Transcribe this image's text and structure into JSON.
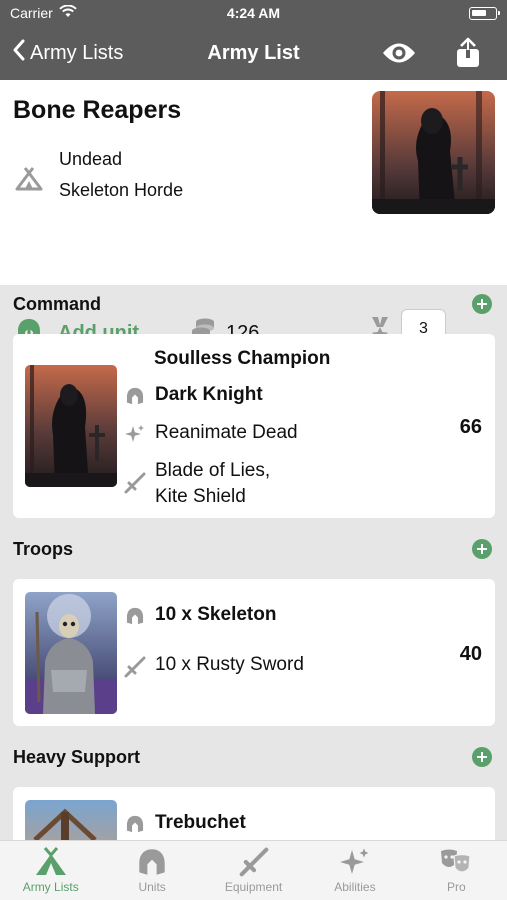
{
  "status_bar": {
    "carrier": "Carrier",
    "time": "4:24 AM"
  },
  "nav": {
    "back_label": "Army Lists",
    "title": "Army List"
  },
  "army": {
    "name": "Bone Reapers",
    "faction_lines": [
      "Undead",
      "Skeleton Horde"
    ],
    "add_unit_label": "Add unit",
    "points": "126",
    "rank_value": "3"
  },
  "sections": [
    {
      "title": "Command",
      "units": [
        {
          "name": "Soulless Champion",
          "type": "Dark Knight",
          "ability": "Reanimate Dead",
          "equipment_lines": [
            "Blade of Lies,",
            "Kite Shield"
          ],
          "points": "66"
        }
      ]
    },
    {
      "title": "Troops",
      "units": [
        {
          "type": "10 x Skeleton",
          "equipment": "10 x Rusty Sword",
          "points": "40"
        }
      ]
    },
    {
      "title": "Heavy Support",
      "units": [
        {
          "type": "Trebuchet"
        }
      ]
    }
  ],
  "tabs": [
    {
      "label": "Army Lists",
      "icon": "tent-icon",
      "active": true
    },
    {
      "label": "Units",
      "icon": "helmet-icon",
      "active": false
    },
    {
      "label": "Equipment",
      "icon": "sword-icon",
      "active": false
    },
    {
      "label": "Abilities",
      "icon": "sparkles-icon",
      "active": false
    },
    {
      "label": "Pro",
      "icon": "masks-icon",
      "active": false
    }
  ],
  "colors": {
    "accent": "#5aa06a",
    "bar": "#5c5c5c",
    "icon_gray": "#9a9a9a"
  }
}
